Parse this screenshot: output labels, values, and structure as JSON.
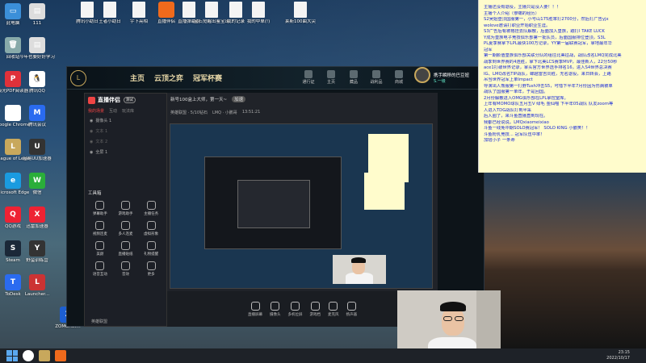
{
  "desktop": {
    "icons_left": [
      {
        "label": "此电脑",
        "color": "#3b8fd9",
        "glyph": "▭"
      },
      {
        "label": "回收站",
        "color": "#8aa",
        "glyph": "🗑"
      },
      {
        "label": "极光PDF阅读器",
        "color": "#e0313a",
        "glyph": "P"
      },
      {
        "label": "Google Chrome",
        "color": "#fff",
        "glyph": "◉"
      },
      {
        "label": "League of Legends",
        "color": "#c8a85c",
        "glyph": "L"
      },
      {
        "label": "Microsoft Edge",
        "color": "#1a9be0",
        "glyph": "e"
      },
      {
        "label": "QQ游戏",
        "color": "#e23",
        "glyph": "Q"
      },
      {
        "label": "Steam",
        "color": "#1b2838",
        "glyph": "S"
      },
      {
        "label": "ToDesk",
        "color": "#2a6bf0",
        "glyph": "T"
      }
    ],
    "icons_left2": [
      {
        "label": "111",
        "color": "#ddd",
        "glyph": "▤"
      },
      {
        "label": "今年也要好好学习",
        "color": "#ddd",
        "glyph": "▤"
      },
      {
        "label": "腾讯QQ",
        "color": "#fff",
        "glyph": "🐧"
      },
      {
        "label": "腾讯会议",
        "color": "#2a6bf0",
        "glyph": "M"
      },
      {
        "label": "网易UU加速器",
        "color": "#333",
        "glyph": "U"
      },
      {
        "label": "微信",
        "color": "#2aae3a",
        "glyph": "W"
      },
      {
        "label": "迅雷加速器",
        "color": "#e23",
        "glyph": "X"
      },
      {
        "label": "野蛮训练营",
        "color": "#333",
        "glyph": "Y"
      },
      {
        "label": "Launcher...",
        "color": "#c33",
        "glyph": "L"
      }
    ],
    "icons_top": [
      {
        "label": "腾讯小助日",
        "type": "file"
      },
      {
        "label": "王者小助日",
        "type": "file"
      },
      {
        "label": "宇下亮相",
        "type": "file"
      },
      {
        "label": "直播伴侣",
        "type": "app",
        "color": "#f06a1c"
      },
      {
        "label": "直播弹幕助",
        "type": "file"
      },
      {
        "label": "宝石觉醒出鉴宝出",
        "type": "file"
      },
      {
        "label": "我的记录",
        "type": "file"
      },
      {
        "label": "我的中单(!)",
        "type": "file"
      },
      {
        "label": "莱斯100曲大尖",
        "type": "file"
      }
    ],
    "zomo_label": "ZOMOnet..."
  },
  "client": {
    "nav": [
      "主页",
      "云顶之弈",
      "冠军杯赛"
    ],
    "top_icons": [
      "通行证",
      "主页",
      "藏品",
      "战利品",
      "商城"
    ],
    "currency": "605",
    "profile_name": "携手瞬移的巴豆妞",
    "profile_sub": "S.一级"
  },
  "obs": {
    "title": "直播伴侣",
    "badge": "测试",
    "tabs": [
      "我的场景",
      "互动",
      "玩法库"
    ],
    "scenes": [
      "摄像头 1",
      "文本 1",
      "文本 2",
      "全屏 1"
    ],
    "toolbox_title": "工具箱",
    "tools": [
      "弹幕助手",
      "游戏助手",
      "主播任务",
      "视频连麦",
      "多人连麦",
      "虚拟形象",
      "美颜",
      "直播贴纸",
      "礼物提醒",
      "语音互动",
      "音效",
      "更多"
    ],
    "footer_label": "英雄联盟"
  },
  "preview": {
    "title": "新号100盒上大师，第一天~",
    "tag": "加速",
    "sub1": "英雄联盟 · 5/10钻石",
    "sub2": "LMQ · 小鹏哥",
    "sub3": "13:51:21",
    "controls": [
      "直播屏幕",
      "摄像头",
      "多机位屏",
      "游戏档",
      "麦克风",
      "扬声器"
    ]
  },
  "notepad": {
    "lines": [
      "主播还没有退役，主播只是没人要！！！",
      "主播个人介绍（惨痛的经历）",
      "S2吴姐登顶国服第一，小号山175胜率打2700分，然后打广告yjx",
      "wolove邀请打职业开始职业生涯。",
      "S3广告后有被格挂去队解散，后面加入皇族，跟打I TAKE LUCK",
      "Y成为皇族电子竞技俱乐部第一批队员，后面国服排位登顶，S3L",
      "PL夏季赛拿下LPL最快100万记录，YY第一届联赛冠军，拿地最年华",
      "冠军",
      "第一期颜值皇族俱乐部关联分队的组往北美征战，战队改名LMQ完成北美",
      "战季到世界赛的4连胜，拿下北美LCS赛季MVP，最佳新人，22分50秒",
      "ace1打破世界记录，拿头官方世界选手排名16，进入S4世界总决赛",
      "IG、LMQ改名TIP战队，蝉越雷吉同胜，无名退役，来日转会，上路",
      "吊当世界冠军上单Impact",
      "导演出人熊服第一打野Tush冲击S5，可惜下半年7月份因为伤病被单",
      "战队了国服第一单年，于是回国。",
      "2月份解散进入OMG俱乐部在LPL拿控室库。",
      "上年有MOMO球队五月五V 绿毛 金仙喵 下半年05战队 队友zoom等",
      "人进入TDG战队打到半采",
      "后入圈了，来斗鱼直播直到现在。",
      "我都已经说说。LMQxiaomeixiao",
      "斗鱼一线免中期SOLO赛冠军！ SOLO KING 小霸笑！！",
      "斗鱼粉乳竞技... 冠军队伍中率！",
      "加班小子 一条命"
    ]
  },
  "taskbar": {
    "time": "23:15",
    "date": "2022/10/17"
  }
}
